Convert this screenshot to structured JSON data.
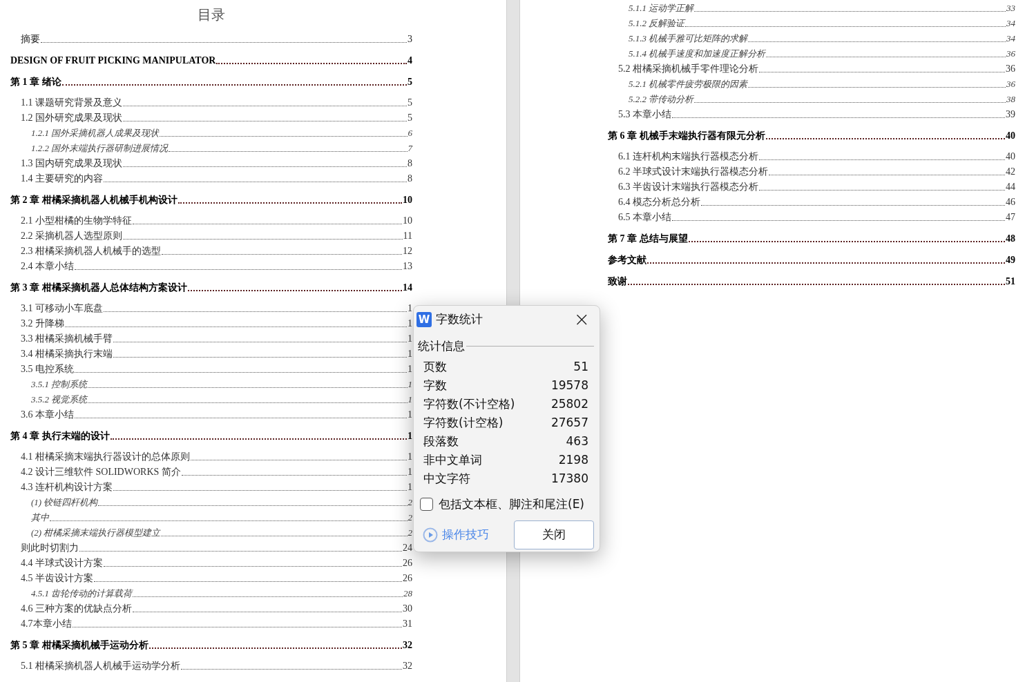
{
  "pages": [
    {
      "title": "目录",
      "entries": [
        {
          "kind": "front",
          "text": "摘要",
          "page": "3"
        },
        {
          "kind": "heading",
          "text": "DESIGN OF FRUIT PICKING MANIPULATOR",
          "page": "4"
        },
        {
          "kind": "heading",
          "text": "第 1 章  绪论",
          "page": "5",
          "children": [
            {
              "kind": "section",
              "text": "1.1 课题研究背景及意义",
              "page": "5"
            },
            {
              "kind": "section",
              "text": "1.2 国外研究成果及现状",
              "page": "5",
              "children": [
                {
                  "kind": "subsection",
                  "text": "1.2.1  国外采摘机器人成果及现状",
                  "page": "6"
                },
                {
                  "kind": "subsection",
                  "text": "1.2.2  国外末端执行器研制进展情况",
                  "page": "7"
                }
              ]
            },
            {
              "kind": "section",
              "text": "1.3 国内研究成果及现状",
              "page": "8"
            },
            {
              "kind": "section",
              "text": "1.4 主要研究的内容",
              "page": "8"
            }
          ]
        },
        {
          "kind": "heading",
          "text": "第 2 章  柑橘采摘机器人机械手机构设计",
          "page": "10",
          "children": [
            {
              "kind": "section",
              "text": "2.1 小型柑橘的生物学特征",
              "page": "10"
            },
            {
              "kind": "section",
              "text": "2.2 采摘机器人选型原则",
              "page": "11"
            },
            {
              "kind": "section",
              "text": "2.3 柑橘采摘机器人机械手的选型",
              "page": "12"
            },
            {
              "kind": "section",
              "text": "2.4 本章小结",
              "page": "13"
            }
          ]
        },
        {
          "kind": "heading",
          "text": "第 3 章  柑橘采摘机器人总体结构方案设计",
          "page": "14",
          "children": [
            {
              "kind": "section",
              "text": "3.1 可移动小车底盘",
              "page": "1"
            },
            {
              "kind": "section",
              "text": "3.2 升降梯",
              "page": "1"
            },
            {
              "kind": "section",
              "text": "3.3 柑橘采摘机械手臂",
              "page": "1"
            },
            {
              "kind": "section",
              "text": "3.4 柑橘采摘执行末端",
              "page": "1"
            },
            {
              "kind": "section",
              "text": "3.5 电控系统",
              "page": "1",
              "children": [
                {
                  "kind": "subsection",
                  "text": "3.5.1  控制系统",
                  "page": "1"
                },
                {
                  "kind": "subsection",
                  "text": "3.5.2  视觉系统",
                  "page": "1"
                }
              ]
            },
            {
              "kind": "section",
              "text": "3.6 本章小结",
              "page": "1"
            }
          ]
        },
        {
          "kind": "heading",
          "text": "第 4 章  执行末端的设计",
          "page": "1",
          "children": [
            {
              "kind": "section",
              "text": "4.1 柑橘采摘末端执行器设计的总体原则",
              "page": "1"
            },
            {
              "kind": "section",
              "text": "4.2 设计三维软件 SOLIDWORKS 简介",
              "page": "1"
            },
            {
              "kind": "section",
              "text": "4.3 连杆机构设计方案",
              "page": "1",
              "children": [
                {
                  "kind": "subsection",
                  "text": "(1)  铰链四杆机构",
                  "page": "2"
                },
                {
                  "kind": "subsection",
                  "text": "其中",
                  "page": "2"
                },
                {
                  "kind": "subsection",
                  "text": "(2)  柑橘采摘末端执行器模型建立",
                  "page": "2"
                }
              ]
            },
            {
              "kind": "section",
              "text": "则此时切割力",
              "page": "24"
            },
            {
              "kind": "section",
              "text": "4.4 半球式设计方案",
              "page": "26"
            },
            {
              "kind": "section",
              "text": "4.5 半齿设计方案",
              "page": "26",
              "children": [
                {
                  "kind": "subsection",
                  "text": "4.5.1  齿轮传动的计算载荷",
                  "page": "28"
                }
              ]
            },
            {
              "kind": "section",
              "text": "4.6 三种方案的优缺点分析",
              "page": "30"
            },
            {
              "kind": "section",
              "text": "4.7本章小结",
              "page": "31"
            }
          ]
        },
        {
          "kind": "heading",
          "text": "第 5 章  柑橘采摘机械手运动分析",
          "page": "32",
          "children": [
            {
              "kind": "section",
              "text": "5.1 柑橘采摘机器人机械手运动学分析",
              "page": "32"
            }
          ]
        }
      ]
    },
    {
      "entries": [
        {
          "kind": "subsection",
          "text": "5.1.1  运动学正解",
          "page": "33"
        },
        {
          "kind": "subsection",
          "text": "5.1.2  反解验证",
          "page": "34"
        },
        {
          "kind": "subsection",
          "text": "5.1.3  机械手雅可比矩阵的求解",
          "page": "34"
        },
        {
          "kind": "subsection",
          "text": "5.1.4  机械手速度和加速度正解分析",
          "page": "36"
        },
        {
          "kind": "section",
          "text": "5.2 柑橘采摘机械手零件理论分析",
          "page": "36",
          "children": [
            {
              "kind": "subsection",
              "text": "5.2.1  机械零件疲劳极限的因素",
              "page": "36"
            },
            {
              "kind": "subsection",
              "text": "5.2.2  带传动分析",
              "page": "38"
            }
          ]
        },
        {
          "kind": "section",
          "text": "5.3 本章小结",
          "page": "39"
        },
        {
          "kind": "heading",
          "text": "第 6 章  机械手末端执行器有限元分析",
          "page": "40",
          "children": [
            {
              "kind": "section",
              "text": "6.1 连杆机构末端执行器模态分析",
              "page": "40"
            },
            {
              "kind": "section",
              "text": "6.2 半球式设计末端执行器模态分析",
              "page": "42"
            },
            {
              "kind": "section",
              "text": "6.3 半齿设计末端执行器模态分析",
              "page": "44"
            },
            {
              "kind": "section",
              "text": "6.4 模态分析总分析",
              "page": "46"
            },
            {
              "kind": "section",
              "text": "6.5 本章小结",
              "page": "47"
            }
          ]
        },
        {
          "kind": "heading",
          "text": "第 7 章  总结与展望",
          "page": "48"
        },
        {
          "kind": "heading",
          "text": "参考文献",
          "page": "49"
        },
        {
          "kind": "heading",
          "text": "致谢",
          "page": "51"
        }
      ]
    }
  ],
  "dialog": {
    "app_icon": "W",
    "title": "字数统计",
    "close": "×",
    "group": "统计信息",
    "stats": [
      {
        "label": "页数",
        "value": "51"
      },
      {
        "label": "字数",
        "value": "19578"
      },
      {
        "label": "字符数(不计空格)",
        "value": "25802"
      },
      {
        "label": "字符数(计空格)",
        "value": "27657"
      },
      {
        "label": "段落数",
        "value": "463"
      },
      {
        "label": "非中文单词",
        "value": "2198"
      },
      {
        "label": "中文字符",
        "value": "17380"
      }
    ],
    "checkbox": {
      "label": "包括文本框、脚注和尾注(E)",
      "checked": false
    },
    "tips_link": "操作技巧",
    "close_button": "关闭"
  }
}
